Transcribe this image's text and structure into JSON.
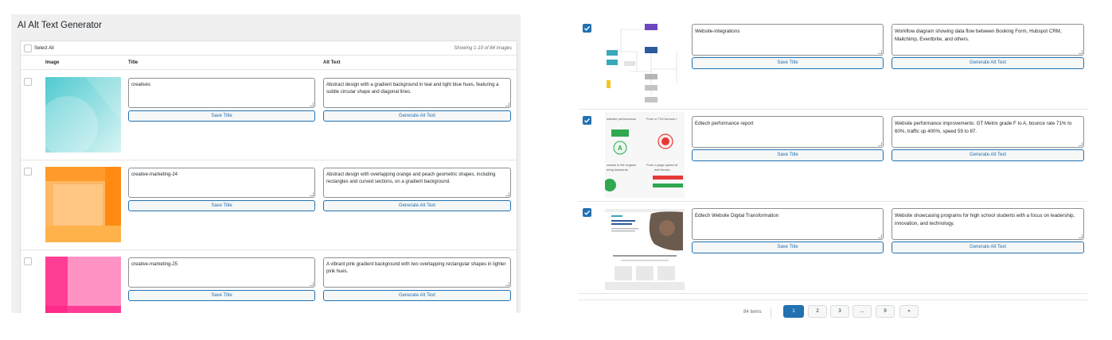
{
  "app_title": "AI Alt Text Generator",
  "toolbar": {
    "select_all": "Select All",
    "showing": "Showing 1-10 of 84 images"
  },
  "columns": {
    "image": "Image",
    "title": "Title",
    "alt": "Alt Text"
  },
  "buttons": {
    "save_title": "Save Title",
    "generate_alt": "Generate Alt Text"
  },
  "left_rows": [
    {
      "title": "creatives",
      "alt": "Abstract design with a gradient background in teal and light blue hues, featuring a subtle circular shape and diagonal lines."
    },
    {
      "title": "creative-marketing-24",
      "alt": "Abstract design with overlapping orange and peach geometric shapes, including rectangles and curved sections, on a gradient background."
    },
    {
      "title": "creative-marketing-25",
      "alt": "A vibrant pink gradient background with two overlapping rectangular shapes in lighter pink hues."
    }
  ],
  "right_rows": [
    {
      "title": "Website-integrations",
      "alt": "Workflow diagram showing data flow between Booking Form, Hubspot CRM, Mailchimp, Eventbrite, and others."
    },
    {
      "title": "Edtech performance report",
      "alt": "Website performance improvements: GT Metrix grade F to A, bounce rate 71% to 60%, traffic up 400%, speed 59 to 87."
    },
    {
      "title": "Edtech Website Digital Transformation",
      "alt": "Website showcasing programs for high school students with a focus on leadership, innovation, and technology."
    }
  ],
  "thumb_text": {
    "perf_label": "website performance",
    "perf_label2": "From a 71% bounce r",
    "perf_grade_a": "A",
    "perf_grade_f": "F",
    "perf_label3": "crease in the organic",
    "perf_label4": "ering keywords",
    "perf_label5": "From a page speed of",
    "perf_label6": "well known"
  },
  "pagination": {
    "items": "84 items",
    "pages": [
      "1",
      "2",
      "3",
      "...",
      "9",
      "»"
    ]
  },
  "colors": {
    "accent": "#2271b1",
    "border": "#8c8f94"
  }
}
